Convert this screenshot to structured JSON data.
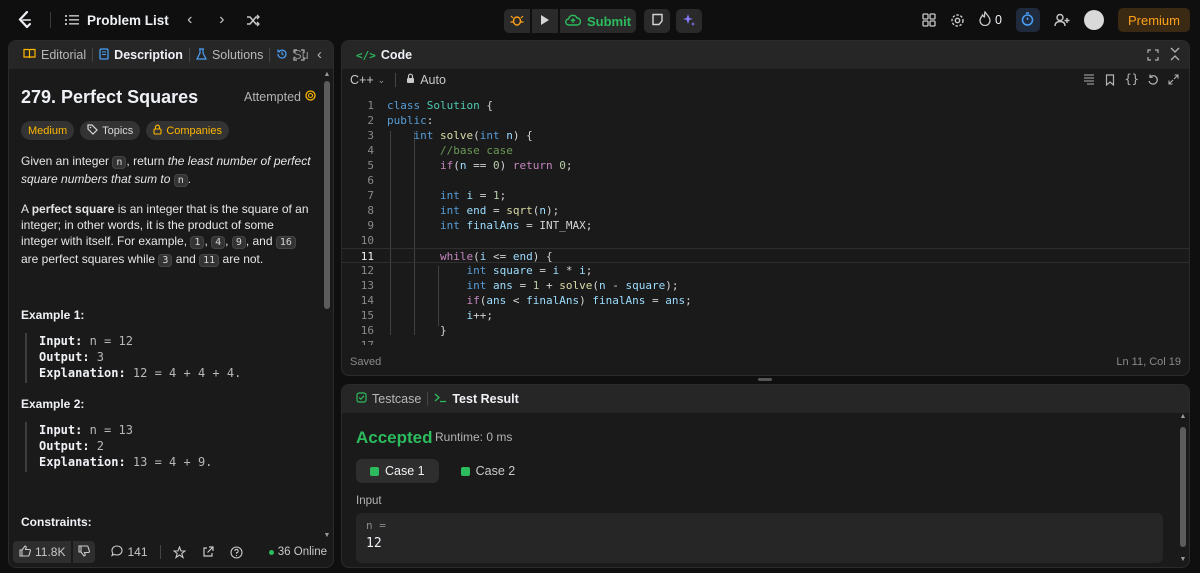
{
  "topbar": {
    "problem_list": "Problem List",
    "submit": "Submit",
    "fire_count": "0",
    "premium": "Premium"
  },
  "left": {
    "tabs": [
      "Editorial",
      "Description",
      "Solutions",
      "Su"
    ],
    "title": "279. Perfect Squares",
    "status": "Attempted",
    "difficulty": "Medium",
    "topics": "Topics",
    "companies": "Companies",
    "desc1_a": "Given an integer ",
    "desc1_n": "n",
    "desc1_b": ", return ",
    "desc1_em": "the least number of perfect square numbers that sum to",
    "desc1_n2": "n",
    "desc1_end": ".",
    "desc2_a": "A ",
    "desc2_strong": "perfect square",
    "desc2_b": " is an integer that is the square of an integer; in other words, it is the product of some integer with itself. For example, ",
    "desc2_c1": "1",
    "desc2_c2": "4",
    "desc2_c3": "9",
    "desc2_and": ", and ",
    "desc2_c4": "16",
    "desc2_d": " are perfect squares while ",
    "desc2_c5": "3",
    "desc2_and2": " and ",
    "desc2_c6": "11",
    "desc2_e": " are not.",
    "ex1_title": "Example 1:",
    "ex1_input_lbl": "Input:",
    "ex1_input": " n = 12",
    "ex1_output_lbl": "Output:",
    "ex1_output": " 3",
    "ex1_expl_lbl": "Explanation:",
    "ex1_expl": " 12 = 4 + 4 + 4.",
    "ex2_title": "Example 2:",
    "ex2_input_lbl": "Input:",
    "ex2_input": " n = 13",
    "ex2_output_lbl": "Output:",
    "ex2_output": " 2",
    "ex2_expl_lbl": "Explanation:",
    "ex2_expl": " 13 = 4 + 9.",
    "constraints": "Constraints:",
    "likes": "11.8K",
    "comments": "141",
    "online": "36 Online"
  },
  "code": {
    "tab": "Code",
    "language": "C++",
    "mode": "Auto",
    "saved": "Saved",
    "cursor": "Ln 11, Col 19",
    "current_line": 11
  },
  "result": {
    "tabs": [
      "Testcase",
      "Test Result"
    ],
    "verdict": "Accepted",
    "runtime": "Runtime: 0 ms",
    "cases": [
      "Case 1",
      "Case 2"
    ],
    "input_label": "Input",
    "input_name": "n =",
    "input_value": "12"
  },
  "colors": {
    "accent_green": "#2cbb5d",
    "medium": "#ffb800",
    "premium": "#ffa116"
  }
}
